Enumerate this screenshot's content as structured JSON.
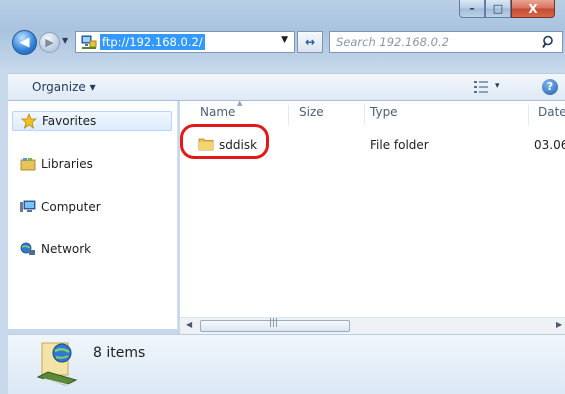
{
  "window": {
    "caption_minimize": "–",
    "caption_maximize": "□",
    "caption_close": "X"
  },
  "nav": {
    "back_glyph": "◀",
    "forward_glyph": "▶",
    "address_value": "ftp://192.168.0.2/",
    "refresh_glyph": "↔",
    "search_placeholder": "Search 192.168.0.2"
  },
  "commandbar": {
    "organize_label": "Organize ▾",
    "view_drop": "▾",
    "help_label": "?"
  },
  "sidebar": {
    "items": [
      {
        "label": "Favorites",
        "icon": "star-icon"
      },
      {
        "label": "Libraries",
        "icon": "libraries-icon"
      },
      {
        "label": "Computer",
        "icon": "computer-icon"
      },
      {
        "label": "Network",
        "icon": "network-icon"
      }
    ]
  },
  "table": {
    "columns": [
      "Name",
      "Size",
      "Type",
      "Date"
    ],
    "rows": [
      {
        "name": "sddisk",
        "size": "",
        "type": "File folder",
        "date": "03.06"
      }
    ]
  },
  "scrollbar": {
    "grip": "|||",
    "left_glyph": "◀",
    "right_glyph": "▶"
  },
  "details": {
    "count_text": "8 items"
  },
  "colors": {
    "selection": "#3399ff",
    "highlight_ring": "#e11919",
    "accent": "#1e395b"
  }
}
